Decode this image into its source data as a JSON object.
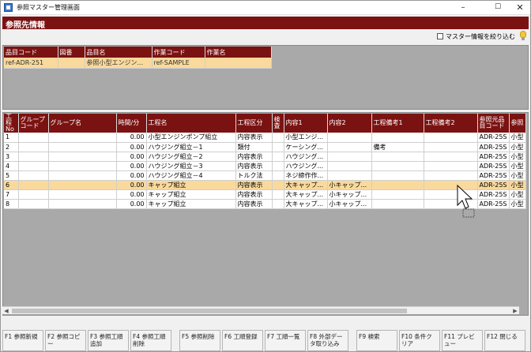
{
  "window": {
    "title": "参照マスター管理画面",
    "icon": "app-window-icon",
    "controls": {
      "minimize": "–",
      "maximize": "☐",
      "close": "✕"
    }
  },
  "header": {
    "title": "参照先情報"
  },
  "toggle": {
    "label": "マスター情報を絞り込む",
    "checked": false
  },
  "colors": {
    "header_bg": "#7b1212",
    "selected_row": "#f9d99c",
    "panel_bg": "#a9a9a9"
  },
  "top_grid": {
    "columns": [
      "品目コード",
      "図番",
      "品目名",
      "作業コード",
      "作業名"
    ],
    "rows": [
      [
        "ref-ADR-251",
        "",
        "参照小型エンジン...",
        "ref-SAMPLE",
        ""
      ]
    ]
  },
  "main_grid": {
    "columns": [
      "工程No",
      "グループコード",
      "グループ名",
      "時間/分",
      "工程名",
      "工程区分",
      "検査",
      "内容1",
      "内容2",
      "工程備考1",
      "工程備考2",
      "参照元品目コード",
      "参照"
    ],
    "rows": [
      [
        "1",
        "",
        "",
        "0.00",
        "小型エンジンポンプ組立",
        "内容表示",
        "",
        "小型エンジ...",
        "",
        "",
        "",
        "ADR-25S",
        "小型"
      ],
      [
        "2",
        "",
        "",
        "0.00",
        "ハウジング組立－1",
        "類付",
        "",
        "ケーシング...",
        "",
        "備考",
        "",
        "ADR-25S",
        "小型"
      ],
      [
        "3",
        "",
        "",
        "0.00",
        "ハウジング組立－2",
        "内容表示",
        "",
        "ハウジング...",
        "",
        "",
        "",
        "ADR-25S",
        "小型"
      ],
      [
        "4",
        "",
        "",
        "0.00",
        "ハウジング組立－3",
        "内容表示",
        "",
        "ハウジング...",
        "",
        "",
        "",
        "ADR-25S",
        "小型"
      ],
      [
        "5",
        "",
        "",
        "0.00",
        "ハウジング組立－4",
        "トルク法",
        "",
        "ネジ締作作...",
        "",
        "",
        "",
        "ADR-25S",
        "小型"
      ],
      [
        "6",
        "",
        "",
        "0.00",
        "キャップ組立",
        "内容表示",
        "",
        "大キャップ...",
        "小キャップ...",
        "",
        "",
        "ADR-25S",
        "小型"
      ],
      [
        "7",
        "",
        "",
        "0.00",
        "キャップ組立",
        "内容表示",
        "",
        "大キャップ...",
        "小キャップ...",
        "",
        "",
        "ADR-25S",
        "小型"
      ],
      [
        "8",
        "",
        "",
        "0.00",
        "キャップ組立",
        "内容表示",
        "",
        "大キャップ...",
        "小キャップ...",
        "",
        "",
        "ADR-25S",
        "小型"
      ]
    ],
    "selected_row": 5
  },
  "function_keys": [
    "F1 参照新規",
    "F2 参照コピー",
    "F3 参照工順追加",
    "F4 参照工順削除",
    "F5 参照削除",
    "F6 工順登録",
    "F7 工順一覧",
    "F8 外部データ取り込み",
    "F9 検索",
    "F10 条件クリア",
    "F11 プレビュー",
    "F12 閉じる"
  ]
}
